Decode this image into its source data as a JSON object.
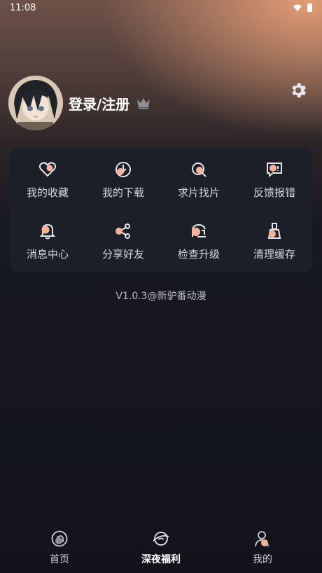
{
  "status_bar": {
    "time": "11:08"
  },
  "profile": {
    "login_label": "登录/注册"
  },
  "menu": {
    "items": [
      {
        "label": "我的收藏",
        "icon": "heart-icon"
      },
      {
        "label": "我的下载",
        "icon": "download-icon"
      },
      {
        "label": "求片找片",
        "icon": "search-film-icon"
      },
      {
        "label": "反馈报错",
        "icon": "feedback-icon"
      },
      {
        "label": "消息中心",
        "icon": "bell-icon"
      },
      {
        "label": "分享好友",
        "icon": "share-icon"
      },
      {
        "label": "检查升级",
        "icon": "update-icon"
      },
      {
        "label": "清理缓存",
        "icon": "clean-icon"
      }
    ]
  },
  "version": "V1.0.3@新驴番动漫",
  "tabs": [
    {
      "label": "首页",
      "icon": "home-icon",
      "active": false
    },
    {
      "label": "深夜福利",
      "icon": "night-icon",
      "active": true
    },
    {
      "label": "我的",
      "icon": "profile-icon",
      "active": false
    }
  ],
  "colors": {
    "accent": "#f3b39a",
    "card": "#1c1e28",
    "background": "#13141b"
  }
}
